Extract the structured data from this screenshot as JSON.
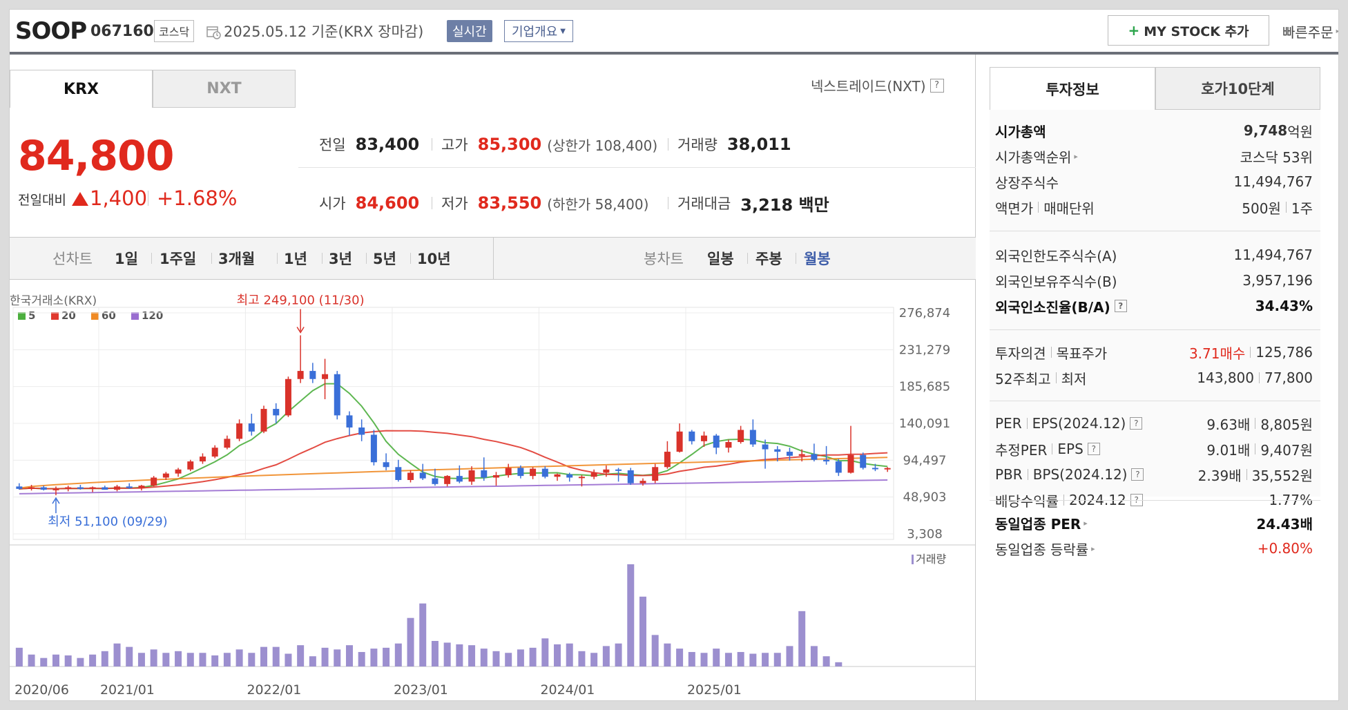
{
  "header": {
    "company_name": "SOOP",
    "stock_code": "067160",
    "market": "코스닥",
    "base_date": "2025.05.12 기준(KRX 장마감)",
    "realtime_label": "실시간",
    "company_info_label": "기업개요",
    "mystock_label": "MY STOCK 추가",
    "quick_order_label": "빠른주문"
  },
  "market_tabs": {
    "krx": "KRX",
    "nxt": "NXT",
    "nxt_link": "넥스트레이드(NXT)"
  },
  "price": {
    "current": "84,800",
    "change_label": "전일대비",
    "change_amount": "1,400",
    "change_rate": "+1.68%"
  },
  "ohlc": {
    "prev_close": {
      "label": "전일",
      "value": "83,400"
    },
    "high": {
      "label": "고가",
      "value": "85,300",
      "sub": "(상한가 108,400)"
    },
    "volume": {
      "label": "거래량",
      "value": "38,011"
    },
    "open": {
      "label": "시가",
      "value": "84,600"
    },
    "low": {
      "label": "저가",
      "value": "83,550",
      "sub": "(하한가 58,400)"
    },
    "trade_value": {
      "label": "거래대금",
      "value": "3,218 백만"
    }
  },
  "period_bar": {
    "line_chart": "선차트",
    "periods": [
      "1일",
      "1주일",
      "3개월",
      "1년",
      "3년",
      "5년",
      "10년"
    ],
    "candle_chart": "봉차트",
    "candle_periods": [
      "일봉",
      "주봉",
      "월봉"
    ],
    "active_candle": "월봉"
  },
  "chart_data": {
    "type": "candlestick",
    "source_label": "한국거래소(KRX)",
    "legend": [
      {
        "name": "5",
        "color": "#4caf3e"
      },
      {
        "name": "20",
        "color": "#e0392f"
      },
      {
        "name": "60",
        "color": "#f08a24"
      },
      {
        "name": "120",
        "color": "#9a6ed0"
      }
    ],
    "y_ticks": [
      "276,874",
      "231,279",
      "185,685",
      "140,091",
      "94,497",
      "48,903",
      "3,308"
    ],
    "ylim": [
      3308,
      276874
    ],
    "x_ticks": [
      "2020/06",
      "2021/01",
      "2022/01",
      "2023/01",
      "2024/01",
      "2025/01"
    ],
    "high_annotation": "최고 249,100 (11/30)",
    "low_annotation": "최저 51,100 (09/29)",
    "volume_label": "거래량",
    "up_color": "#d9322a",
    "down_color": "#3a6fd8",
    "volume_color": "#9c8fcf",
    "candles": [
      [
        62000,
        66000,
        58000,
        59000
      ],
      [
        59000,
        64000,
        57000,
        61000
      ],
      [
        61000,
        63000,
        57000,
        58000
      ],
      [
        58000,
        62000,
        51100,
        59000
      ],
      [
        59000,
        63000,
        56000,
        61000
      ],
      [
        61000,
        64000,
        58000,
        59000
      ],
      [
        59000,
        62000,
        55000,
        61000
      ],
      [
        61000,
        63000,
        58000,
        58000
      ],
      [
        58000,
        64000,
        56000,
        62000
      ],
      [
        62000,
        66000,
        59000,
        60000
      ],
      [
        60000,
        64000,
        57000,
        63000
      ],
      [
        63000,
        75000,
        62000,
        73000
      ],
      [
        73000,
        80000,
        70000,
        78000
      ],
      [
        78000,
        85000,
        74000,
        83000
      ],
      [
        83000,
        95000,
        81000,
        93000
      ],
      [
        93000,
        103000,
        90000,
        99000
      ],
      [
        99000,
        113000,
        97000,
        110000
      ],
      [
        110000,
        125000,
        108000,
        121000
      ],
      [
        121000,
        145000,
        118000,
        140000
      ],
      [
        140000,
        152000,
        125000,
        130000
      ],
      [
        130000,
        162000,
        128000,
        158000
      ],
      [
        158000,
        165000,
        140000,
        150000
      ],
      [
        150000,
        198000,
        148000,
        195000
      ],
      [
        195000,
        249100,
        190000,
        205000
      ],
      [
        205000,
        215000,
        190000,
        195000
      ],
      [
        195000,
        220000,
        170000,
        201000
      ],
      [
        201000,
        205000,
        145000,
        150000
      ],
      [
        150000,
        155000,
        125000,
        135000
      ],
      [
        135000,
        145000,
        118000,
        126000
      ],
      [
        126000,
        132000,
        88000,
        92000
      ],
      [
        92000,
        103000,
        82000,
        86000
      ],
      [
        86000,
        95000,
        68000,
        70000
      ],
      [
        70000,
        82000,
        67000,
        79000
      ],
      [
        79000,
        90000,
        70000,
        72000
      ],
      [
        72000,
        84000,
        63000,
        65000
      ],
      [
        65000,
        76000,
        62000,
        75000
      ],
      [
        75000,
        88000,
        66000,
        68000
      ],
      [
        68000,
        87000,
        64000,
        82000
      ],
      [
        82000,
        98000,
        69000,
        73000
      ],
      [
        73000,
        80000,
        63000,
        76000
      ],
      [
        76000,
        90000,
        73000,
        85000
      ],
      [
        85000,
        88000,
        72000,
        75000
      ],
      [
        75000,
        86000,
        71000,
        84000
      ],
      [
        84000,
        87000,
        72000,
        74000
      ],
      [
        74000,
        78000,
        69000,
        77000
      ],
      [
        77000,
        79000,
        68000,
        73000
      ],
      [
        73000,
        76000,
        62000,
        74000
      ],
      [
        74000,
        83000,
        71000,
        79000
      ],
      [
        79000,
        88000,
        74000,
        83000
      ],
      [
        83000,
        85000,
        68000,
        82000
      ],
      [
        82000,
        85000,
        64000,
        66000
      ],
      [
        66000,
        72000,
        63000,
        69000
      ],
      [
        69000,
        90000,
        66000,
        86000
      ],
      [
        86000,
        118000,
        84000,
        105000
      ],
      [
        105000,
        140000,
        104000,
        130000
      ],
      [
        130000,
        132000,
        114000,
        118000
      ],
      [
        118000,
        130000,
        111000,
        125000
      ],
      [
        125000,
        127000,
        102000,
        110000
      ],
      [
        110000,
        120000,
        104000,
        117000
      ],
      [
        117000,
        137000,
        115000,
        132000
      ],
      [
        132000,
        145000,
        111000,
        114000
      ],
      [
        114000,
        120000,
        84000,
        108000
      ],
      [
        108000,
        112000,
        93000,
        105000
      ],
      [
        105000,
        110000,
        94000,
        100000
      ],
      [
        100000,
        108000,
        93000,
        102000
      ],
      [
        102000,
        115000,
        93000,
        95000
      ],
      [
        95000,
        112000,
        89000,
        93000
      ],
      [
        93000,
        96000,
        75000,
        79000
      ],
      [
        79000,
        137000,
        78000,
        101000
      ],
      [
        101000,
        104000,
        83000,
        85000
      ],
      [
        85000,
        90000,
        81000,
        84000
      ],
      [
        84000,
        86000,
        80000,
        84800
      ]
    ],
    "volumes": [
      22,
      14,
      10,
      14,
      13,
      10,
      14,
      18,
      27,
      23,
      16,
      20,
      16,
      18,
      16,
      16,
      13,
      16,
      20,
      16,
      23,
      23,
      15,
      25,
      12,
      22,
      20,
      25,
      17,
      21,
      22,
      27,
      57,
      74,
      30,
      28,
      26,
      25,
      21,
      18,
      16,
      20,
      22,
      33,
      26,
      27,
      18,
      16,
      24,
      27,
      120,
      82,
      37,
      27,
      21,
      17,
      16,
      21,
      16,
      17,
      15,
      16,
      16,
      24,
      65,
      24,
      12,
      5
    ]
  },
  "invest_tabs": {
    "invest_info": "투자정보",
    "hoga": "호가10단계"
  },
  "invest_info": {
    "market_cap": {
      "label": "시가총액",
      "value": "9,748",
      "unit": "억원"
    },
    "market_cap_rank": {
      "label": "시가총액순위",
      "value": "코스닥 53위"
    },
    "listed_shares": {
      "label": "상장주식수",
      "value": "11,494,767"
    },
    "par_value": {
      "label": "액면가",
      "label2": "매매단위",
      "value": "500원",
      "value2": "1주"
    },
    "foreign_limit": {
      "label": "외국인한도주식수(A)",
      "value": "11,494,767"
    },
    "foreign_hold": {
      "label": "외국인보유주식수(B)",
      "value": "3,957,196"
    },
    "foreign_rate": {
      "label": "외국인소진율(B/A)",
      "value": "34.43%"
    },
    "opinion": {
      "label": "투자의견",
      "label2": "목표주가",
      "value": "3.71매수",
      "value2": "125,786"
    },
    "week52": {
      "label": "52주최고",
      "label2": "최저",
      "value": "143,800",
      "value2": "77,800"
    },
    "per": {
      "label": "PER",
      "label2": "EPS(2024.12)",
      "value": "9.63배",
      "value2": "8,805원"
    },
    "est_per": {
      "label": "추정PER",
      "label2": "EPS",
      "value": "9.01배",
      "value2": "9,407원"
    },
    "pbr": {
      "label": "PBR",
      "label2": "BPS(2024.12)",
      "value": "2.39배",
      "value2": "35,552원"
    },
    "dividend": {
      "label": "배당수익률",
      "label2": "2024.12",
      "value": "1.77%"
    },
    "sector_per": {
      "label": "동일업종 PER",
      "value": "24.43배"
    },
    "sector_rate": {
      "label": "동일업종 등락률",
      "value": "+0.80%"
    }
  }
}
